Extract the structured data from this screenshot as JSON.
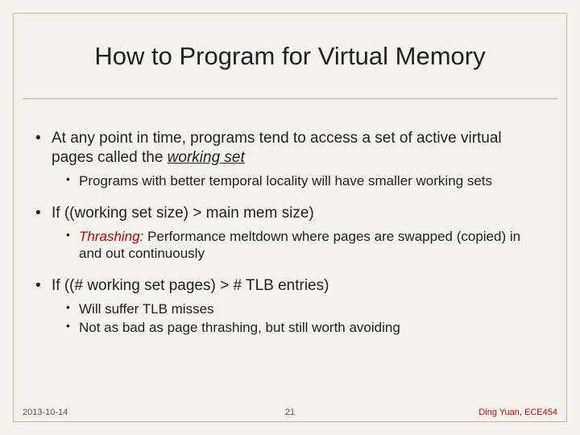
{
  "title": "How to Program for Virtual Memory",
  "bullets": {
    "b1_pre": "At any point in time, programs tend to access a set of active virtual pages called the ",
    "b1_em": "working set",
    "b1_1": "Programs with better temporal locality will have smaller working sets",
    "b2": "If ((working set size) > main mem size)",
    "b2_1_em": "Thrashing:",
    "b2_1_rest": " Performance meltdown where pages are swapped (copied) in and out continuously",
    "b3": "If ((# working set pages) > # TLB entries)",
    "b3_1": "Will suffer TLB misses",
    "b3_2": "Not as bad as page thrashing, but still worth avoiding"
  },
  "footer": {
    "date": "2013-10-14",
    "page": "21",
    "author": "Ding Yuan, ECE454"
  }
}
